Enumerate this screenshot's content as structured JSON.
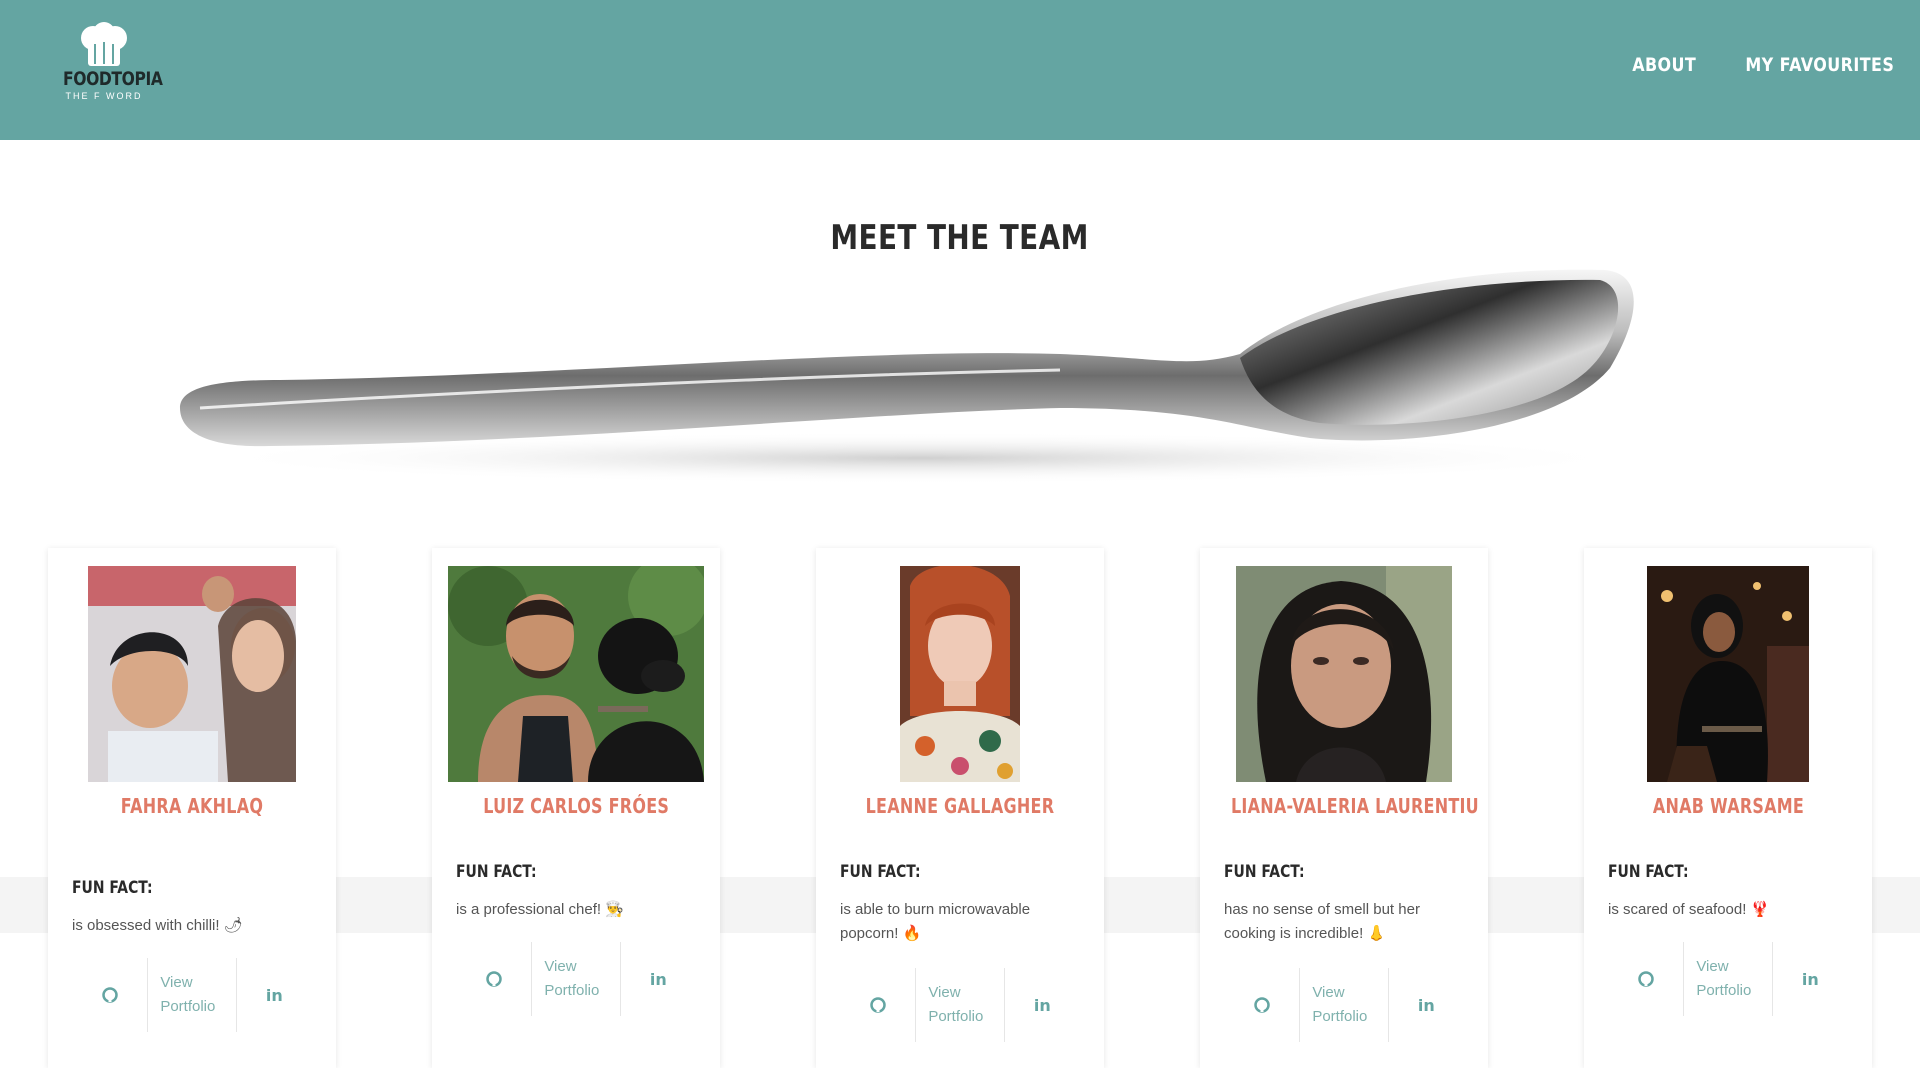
{
  "brand": {
    "name": "FOODTOPIA",
    "tagline": "THE F WORD"
  },
  "nav": {
    "about": "ABOUT",
    "favourites": "MY FAVOURITES"
  },
  "page_title": "MEET THE TEAM",
  "colors": {
    "header": "#64a5a2",
    "name_accent": "#e07a66",
    "icon": "#64a5a2"
  },
  "team": [
    {
      "name": "FAHRA AKHLAQ",
      "fact_label": "FUN FACT:",
      "fact": "is obsessed with chilli! 🌶",
      "portfolio_label": "View Portfolio",
      "github_icon": "github-icon",
      "linkedin_icon": "linkedin-icon"
    },
    {
      "name": "LUIZ CARLOS FRÓES",
      "fact_label": "FUN FACT:",
      "fact": "is a professional chef! 👨‍🍳",
      "portfolio_label": "View Portfolio",
      "github_icon": "github-icon",
      "linkedin_icon": "linkedin-icon"
    },
    {
      "name": "LEANNE GALLAGHER",
      "fact_label": "FUN FACT:",
      "fact": "is able to burn microwavable popcorn! 🔥",
      "portfolio_label": "View Portfolio",
      "github_icon": "github-icon",
      "linkedin_icon": "linkedin-icon"
    },
    {
      "name": "LIANA-VALERIA LAURENTIU",
      "fact_label": "FUN FACT:",
      "fact": "has no sense of smell but her cooking is incredible! 👃",
      "portfolio_label": "View Portfolio",
      "github_icon": "github-icon",
      "linkedin_icon": "linkedin-icon"
    },
    {
      "name": "ANAB WARSAME",
      "fact_label": "FUN FACT:",
      "fact": "is scared of seafood! 🦞",
      "portfolio_label": "View Portfolio",
      "github_icon": "github-icon",
      "linkedin_icon": "linkedin-icon"
    }
  ]
}
